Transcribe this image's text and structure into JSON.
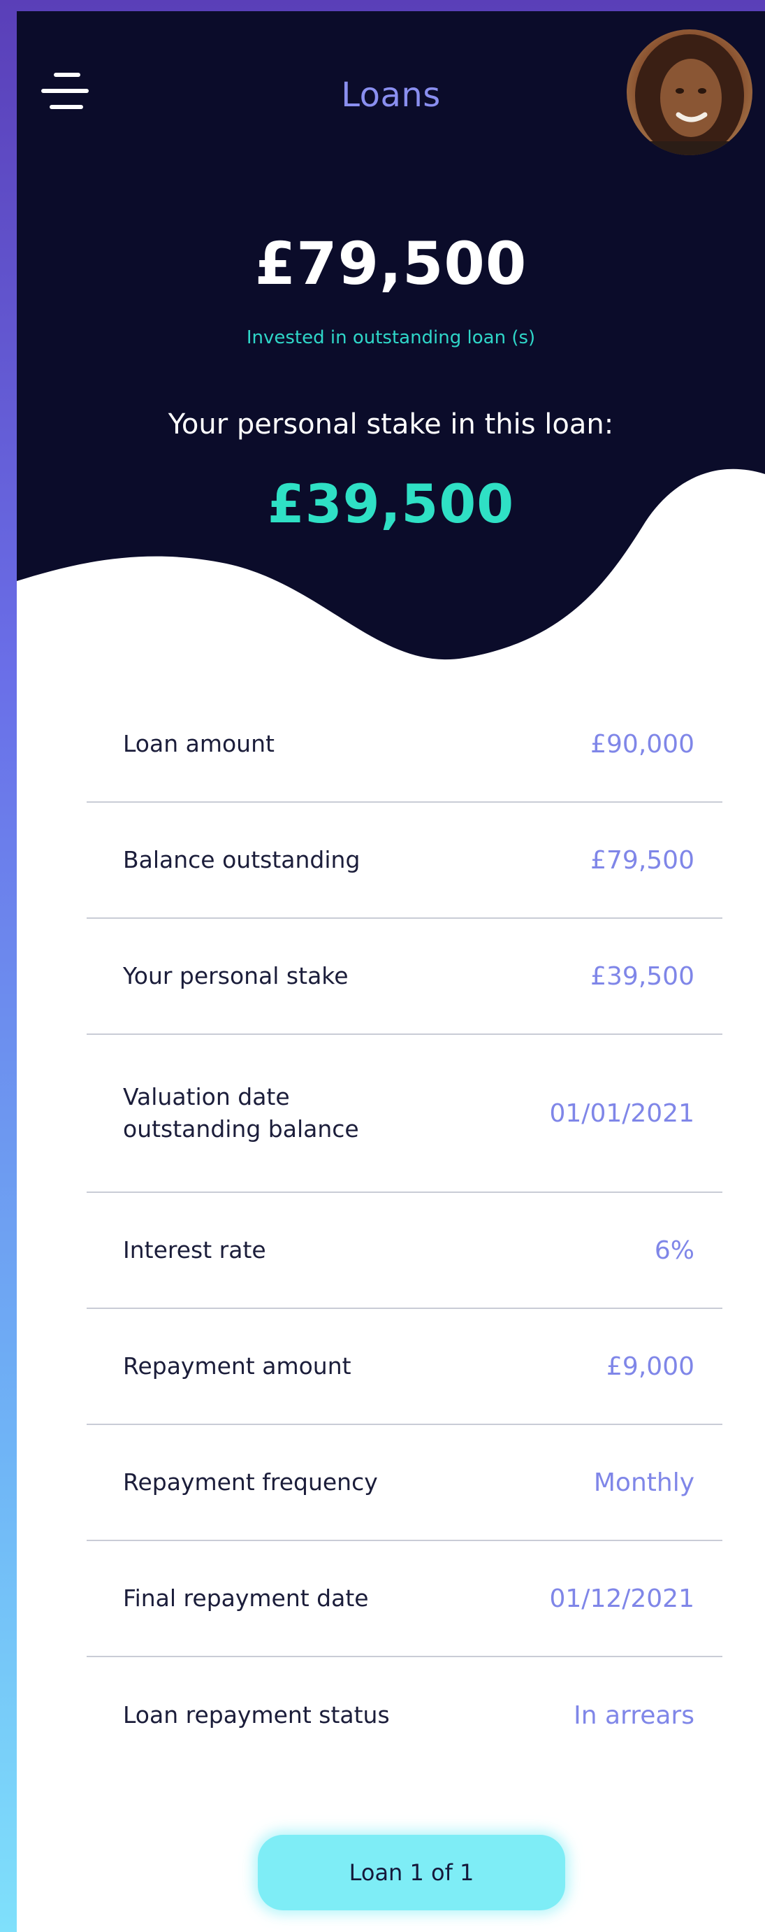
{
  "header": {
    "title": "Loans",
    "menu_icon": "hamburger-menu-icon",
    "avatar": "user-avatar-photo"
  },
  "summary": {
    "invested_amount": "£79,500",
    "invested_label": "Invested in outstanding loan (s)",
    "stake_label": "Your personal stake in this loan:",
    "stake_amount": "£39,500"
  },
  "details": [
    {
      "label": "Loan amount",
      "value": "£90,000"
    },
    {
      "label": "Balance outstanding",
      "value": "£79,500"
    },
    {
      "label": "Your personal stake",
      "value": "£39,500"
    },
    {
      "label": "Valuation date\noutstanding balance",
      "value": "01/01/2021"
    },
    {
      "label": "Interest rate",
      "value": "6%"
    },
    {
      "label": "Repayment amount",
      "value": "£9,000"
    },
    {
      "label": "Repayment frequency",
      "value": "Monthly"
    },
    {
      "label": "Final repayment date",
      "value": "01/12/2021"
    },
    {
      "label": "Loan repayment status",
      "value": "In arrears"
    }
  ],
  "pager": {
    "label": "Loan 1 of 1"
  },
  "colors": {
    "hero_background": "#0b0c2a",
    "accent_teal": "#2fe0c5",
    "value_purple": "#7f86e8",
    "pager_background": "#7eedf6"
  }
}
